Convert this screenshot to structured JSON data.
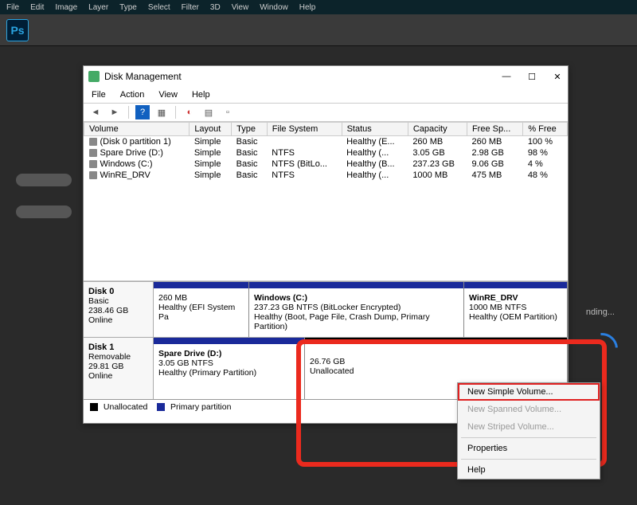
{
  "ps": {
    "menu": [
      "File",
      "Edit",
      "Image",
      "Layer",
      "Type",
      "Select",
      "Filter",
      "3D",
      "View",
      "Window",
      "Help"
    ],
    "logo": "Ps",
    "loading": "nding..."
  },
  "dm": {
    "title": "Disk Management",
    "menu": [
      "File",
      "Action",
      "View",
      "Help"
    ],
    "winbtns": {
      "min": "—",
      "max": "☐",
      "close": "✕"
    },
    "columns": [
      "Volume",
      "Layout",
      "Type",
      "File System",
      "Status",
      "Capacity",
      "Free Sp...",
      "% Free"
    ],
    "rows": [
      {
        "volume": "(Disk 0 partition 1)",
        "layout": "Simple",
        "type": "Basic",
        "fs": "",
        "status": "Healthy (E...",
        "capacity": "260 MB",
        "free": "260 MB",
        "pct": "100 %"
      },
      {
        "volume": "Spare Drive (D:)",
        "layout": "Simple",
        "type": "Basic",
        "fs": "NTFS",
        "status": "Healthy (...",
        "capacity": "3.05 GB",
        "free": "2.98 GB",
        "pct": "98 %"
      },
      {
        "volume": "Windows (C:)",
        "layout": "Simple",
        "type": "Basic",
        "fs": "NTFS (BitLo...",
        "status": "Healthy (B...",
        "capacity": "237.23 GB",
        "free": "9.06 GB",
        "pct": "4 %"
      },
      {
        "volume": "WinRE_DRV",
        "layout": "Simple",
        "type": "Basic",
        "fs": "NTFS",
        "status": "Healthy (...",
        "capacity": "1000 MB",
        "free": "475 MB",
        "pct": "48 %"
      }
    ],
    "disks": {
      "d0": {
        "label_title": "Disk 0",
        "label_type": "Basic",
        "label_size": "238.46 GB",
        "label_status": "Online",
        "p1_l1": "",
        "p1_l2": "260 MB",
        "p1_l3": "Healthy (EFI System Pa",
        "p2_title": "Windows  (C:)",
        "p2_l2": "237.23 GB NTFS (BitLocker Encrypted)",
        "p2_l3": "Healthy (Boot, Page File, Crash Dump, Primary Partition)",
        "p3_title": "WinRE_DRV",
        "p3_l2": "1000 MB NTFS",
        "p3_l3": "Healthy (OEM Partition)"
      },
      "d1": {
        "label_title": "Disk 1",
        "label_type": "Removable",
        "label_size": "29.81 GB",
        "label_status": "Online",
        "p1_title": "Spare Drive  (D:)",
        "p1_l2": "3.05 GB NTFS",
        "p1_l3": "Healthy (Primary Partition)",
        "p2_l2": "26.76 GB",
        "p2_l3": "Unallocated"
      }
    },
    "legend": {
      "unalloc": "Unallocated",
      "primary": "Primary partition"
    }
  },
  "ctx": {
    "items": {
      "simple": "New Simple Volume...",
      "spanned": "New Spanned Volume...",
      "striped": "New Striped Volume...",
      "properties": "Properties",
      "help": "Help"
    }
  }
}
